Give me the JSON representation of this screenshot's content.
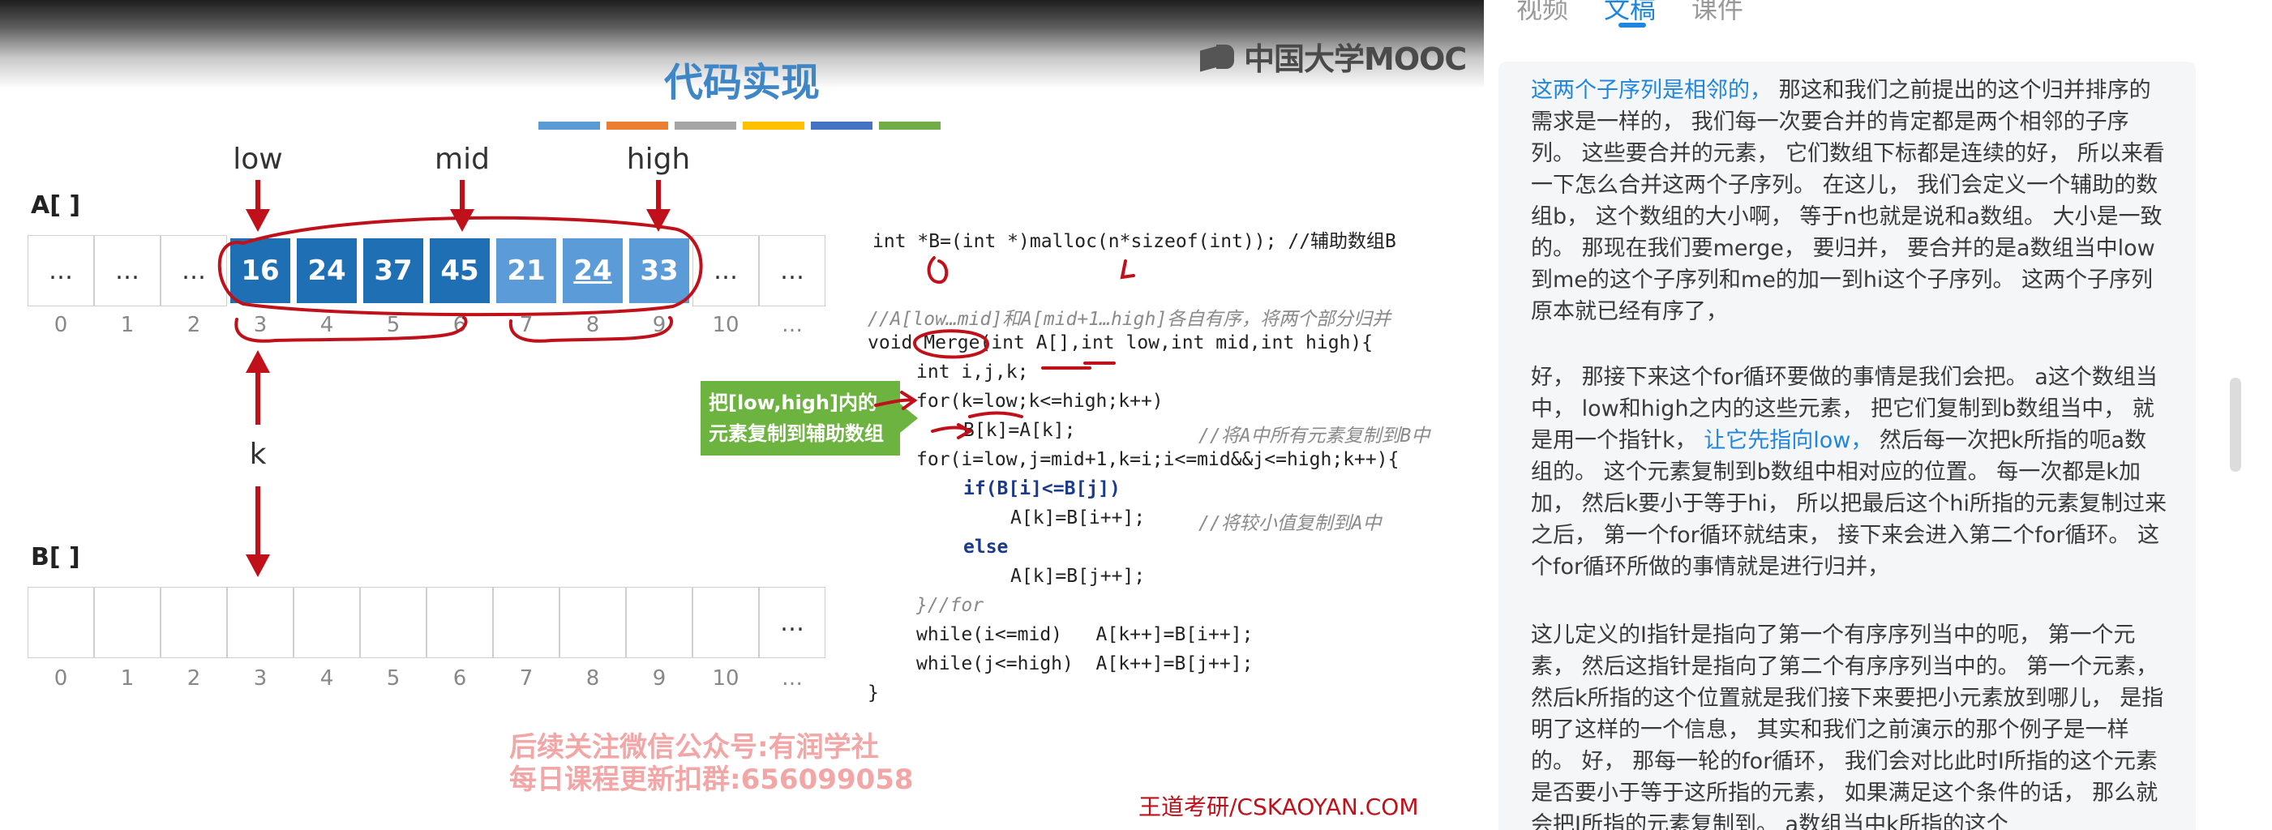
{
  "slide": {
    "logo": "中国大学MOOC",
    "title": "代码实现",
    "color_strip": [
      "#5b9bd5",
      "#ed7d31",
      "#a5a5a5",
      "#ffc000",
      "#4472c4",
      "#70ad47"
    ],
    "pointers": {
      "low": "low",
      "mid": "mid",
      "high": "high",
      "k": "k"
    },
    "array_a": {
      "label": "A[ ]",
      "cells": [
        "…",
        "…",
        "…",
        "16",
        "24",
        "37",
        "45",
        "21",
        "24",
        "33",
        "…",
        "…"
      ],
      "indices": [
        "0",
        "1",
        "2",
        "3",
        "4",
        "5",
        "6",
        "7",
        "8",
        "9",
        "10",
        "…"
      ]
    },
    "array_b": {
      "label": "B[ ]",
      "cells": [
        "",
        "",
        "",
        "",
        "",
        "",
        "",
        "",
        "",
        "",
        "",
        "…"
      ],
      "indices": [
        "0",
        "1",
        "2",
        "3",
        "4",
        "5",
        "6",
        "7",
        "8",
        "9",
        "10",
        "…"
      ]
    },
    "code": {
      "line1": "int *B=(int *)malloc(n*sizeof(int)); //辅助数组B",
      "comment_heading": "//A[low…mid]和A[mid+1…high]各自有序，将两个部分归并",
      "line_func": "void Merge(int A[],int low,int mid,int high){",
      "line_decl": "int i,j,k;",
      "line_for1": "for(k=low;k<=high;k++)",
      "line_copy": "B[k]=A[k];",
      "comment_copy": "//将A中所有元素复制到B中",
      "line_for2": "for(i=low,j=mid+1,k=i;i<=mid&&j<=high;k++){",
      "line_if": "if(B[i]<=B[j])",
      "line_assign1": "A[k]=B[i++];",
      "comment_assign": "//将较小值复制到A中",
      "line_else": "else",
      "line_assign2": "A[k]=B[j++];",
      "line_close_for": "}//for",
      "line_while1": "while(i<=mid)   A[k++]=B[i++];",
      "line_while2": "while(j<=high)  A[k++]=B[j++];",
      "line_close_func": "}"
    },
    "callout": "把[low,high]内的元素复制到辅助数组B",
    "promo_line1": "后续关注微信公众号:有润学社",
    "promo_line2": "每日课程更新扣群:656099058",
    "credit": "王道考研/CSKAOYAN.COM"
  },
  "side_panel": {
    "tabs": [
      "视频",
      "文稿",
      "课件"
    ],
    "active_tab": "文稿",
    "paragraphs": [
      {
        "highlight": "这两个子序列是相邻的，",
        "text": " 那这和我们之前提出的这个归并排序的需求是一样的， 我们每一次要合并的肯定都是两个相邻的子序列。 这些要合并的元素， 它们数组下标都是连续的好， 所以来看一下怎么合并这两个子序列。 在这儿， 我们会定义一个辅助的数组b， 这个数组的大小啊， 等于n也就是说和a数组。 大小是一致的。 那现在我们要merge， 要归并， 要合并的是a数组当中low到me的这个子序列和me的加一到hi这个子序列。 这两个子序列原本就已经有序了，"
      },
      {
        "before": "好， 那接下来这个for循环要做的事情是我们会把。 a这个数组当中， low和high之内的这些元素， 把它们复制到b数组当中， 就是用一个指针k， ",
        "highlight": "让它先指向low，",
        "after": " 然后每一次把k所指的呃a数组的。 这个元素复制到b数组中相对应的位置。 每一次都是k加加， 然后k要小于等于hi， 所以把最后这个hi所指的元素复制过来之后， 第一个for循环就结束， 接下来会进入第二个for循环。 这个for循环所做的事情就是进行归并，"
      },
      {
        "text": "这儿定义的I指针是指向了第一个有序序列当中的呃， 第一个元素， 然后这指针是指向了第二个有序序列当中的。 第一个元素， 然后k所指的这个位置就是我们接下来要把小元素放到哪儿， 是指明了这样的一个信息， 其实和我们之前演示的那个例子是一样的。 好， 那每一轮的for循环， 我们会对比此时I所指的这个元素是否要小于等于这所指的元素， 如果满足这个条件的话， 那么就会把I所指的元素复制到。 a数组当中k所指的这个"
      }
    ]
  }
}
